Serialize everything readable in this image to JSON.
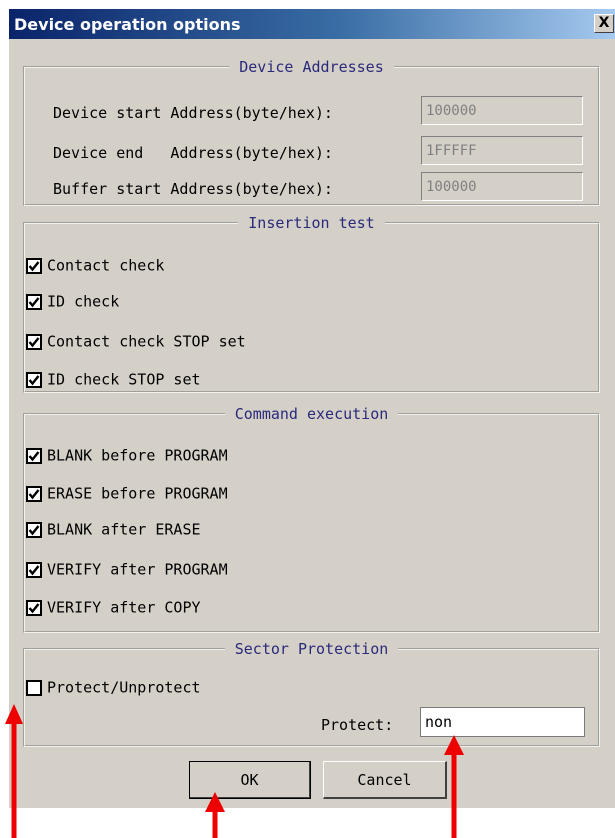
{
  "window": {
    "title": "Device operation options",
    "close_label": "X"
  },
  "device_addresses": {
    "legend": "Device Addresses",
    "rows": [
      {
        "label": "Device start Address(byte/hex):",
        "value": "100000"
      },
      {
        "label": "Device end   Address(byte/hex):",
        "value": "1FFFFF"
      },
      {
        "label": "Buffer start Address(byte/hex):",
        "value": "100000"
      }
    ]
  },
  "insertion_test": {
    "legend": "Insertion test",
    "items": [
      {
        "label": "Contact check",
        "checked": true
      },
      {
        "label": "ID check",
        "checked": true
      },
      {
        "label": "Contact check STOP set",
        "checked": true
      },
      {
        "label": "ID check STOP set",
        "checked": true
      }
    ]
  },
  "command_execution": {
    "legend": "Command execution",
    "items": [
      {
        "label": "BLANK before PROGRAM",
        "checked": true
      },
      {
        "label": "ERASE before PROGRAM",
        "checked": true
      },
      {
        "label": "BLANK after ERASE",
        "checked": true
      },
      {
        "label": "VERIFY after PROGRAM",
        "checked": true
      },
      {
        "label": "VERIFY after COPY",
        "checked": true
      }
    ]
  },
  "sector_protection": {
    "legend": "Sector Protection",
    "checkbox_label": "Protect/Unprotect",
    "checked": false,
    "protect_label": "Protect:",
    "protect_value": "non"
  },
  "buttons": {
    "ok": "OK",
    "cancel": "Cancel"
  },
  "colors": {
    "arrow": "#ee0000",
    "legend_text": "#2a2a7c",
    "dialog_bg": "#d4d0c8"
  }
}
